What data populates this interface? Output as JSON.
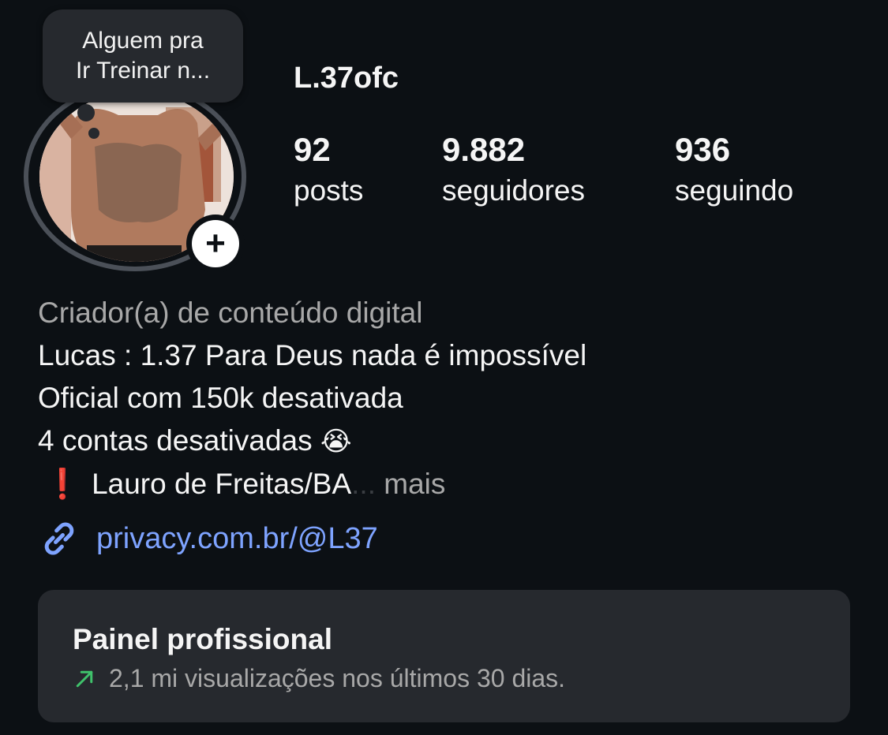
{
  "profile": {
    "note": [
      "Alguem pra",
      "Ir Treinar n..."
    ],
    "username": "L.37ofc",
    "add_story_symbol": "+"
  },
  "stats": [
    {
      "value": "92",
      "label": "posts"
    },
    {
      "value": "9.882",
      "label": "seguidores"
    },
    {
      "value": "936",
      "label": "seguindo"
    }
  ],
  "bio": {
    "category": "Criador(a) de conteúdo digital",
    "lines": [
      "Lucas : 1.37 Para Deus nada é impossível",
      "Oficial com 150k desativada",
      "4 contas desativadas"
    ],
    "line3_emoji": "😭",
    "location_prefix": "❗",
    "location": "Lauro de Freitas/BA",
    "ellipsis": "...",
    "more_label": "mais"
  },
  "link": {
    "icon": "link-icon",
    "text": "privacy.com.br/@L37"
  },
  "panel": {
    "title": "Painel profissional",
    "icon": "trend-up-arrow-icon",
    "subtitle": "2,1 mi visualizações nos últimos 30 dias."
  },
  "colors": {
    "background": "#0c1014",
    "panel": "#26292e",
    "link": "#7ea3ff",
    "trend": "#3fc26b",
    "secondary_text": "#a8a8a8"
  }
}
